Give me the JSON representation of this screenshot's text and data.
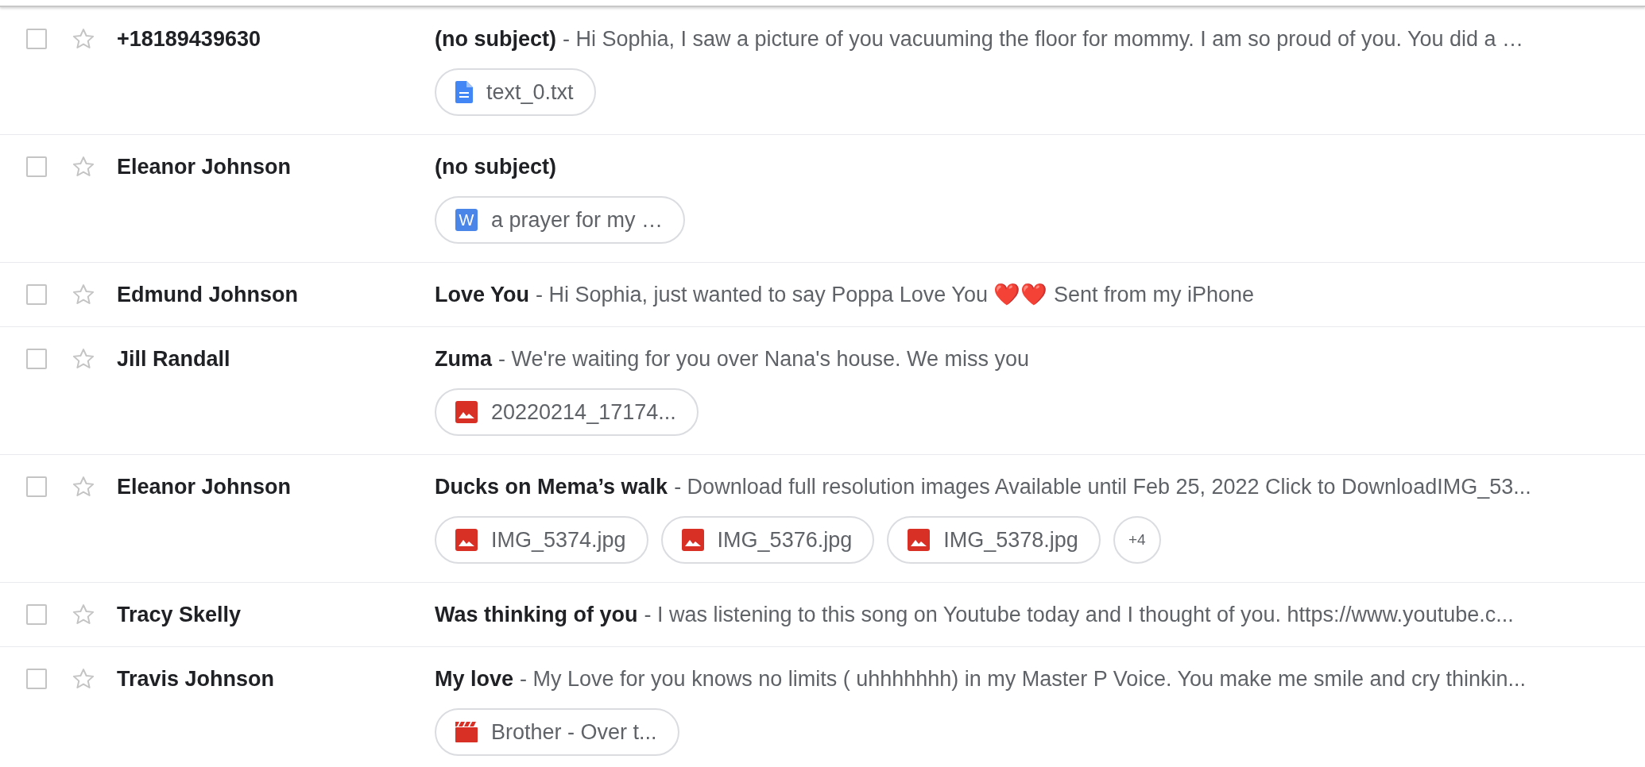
{
  "messages": [
    {
      "checked": false,
      "starred": false,
      "sender": "+18189439630",
      "subject": "(no subject)",
      "snippet": "- Hi Sophia, I saw a picture of you vacuuming the floor for mommy. I am so proud of you. You did a …",
      "attachments": [
        {
          "kind": "doc",
          "name": "text_0.txt"
        }
      ]
    },
    {
      "checked": false,
      "starred": false,
      "sender": "Eleanor Johnson",
      "subject": "(no subject)",
      "attachments": [
        {
          "kind": "word",
          "name": "a prayer for my …",
          "icon_letter": "W"
        }
      ]
    },
    {
      "checked": false,
      "starred": false,
      "sender": "Edmund Johnson",
      "subject": "Love You",
      "snippet": "- Hi Sophia, just wanted to say Poppa Love You ❤️❤️ Sent from my iPhone"
    },
    {
      "checked": false,
      "starred": false,
      "sender": "Jill Randall",
      "subject": "Zuma",
      "snippet": "- We're waiting for you over Nana's house. We miss you",
      "attachments": [
        {
          "kind": "image",
          "name": "20220214_17174..."
        }
      ]
    },
    {
      "checked": false,
      "starred": false,
      "sender": "Eleanor Johnson",
      "subject": "Ducks on Mema’s walk",
      "snippet": "- Download full resolution images Available until Feb 25, 2022 Click to DownloadIMG_53...",
      "attachments": [
        {
          "kind": "image",
          "name": "IMG_5374.jpg"
        },
        {
          "kind": "image",
          "name": "IMG_5376.jpg"
        },
        {
          "kind": "image",
          "name": "IMG_5378.jpg"
        },
        {
          "kind": "more",
          "name": "+4"
        }
      ]
    },
    {
      "checked": false,
      "starred": false,
      "sender": "Tracy Skelly",
      "subject": "Was thinking of you",
      "snippet": "- I was listening to this song on Youtube today and I thought of you. https://www.youtube.c..."
    },
    {
      "checked": false,
      "starred": false,
      "sender": "Travis Johnson",
      "subject": "My love",
      "snippet": "- My Love for you knows no limits ( uhhhhhhh) in my Master P Voice. You make me smile and cry thinkin...",
      "attachments": [
        {
          "kind": "video",
          "name": "Brother - Over t..."
        }
      ]
    }
  ]
}
